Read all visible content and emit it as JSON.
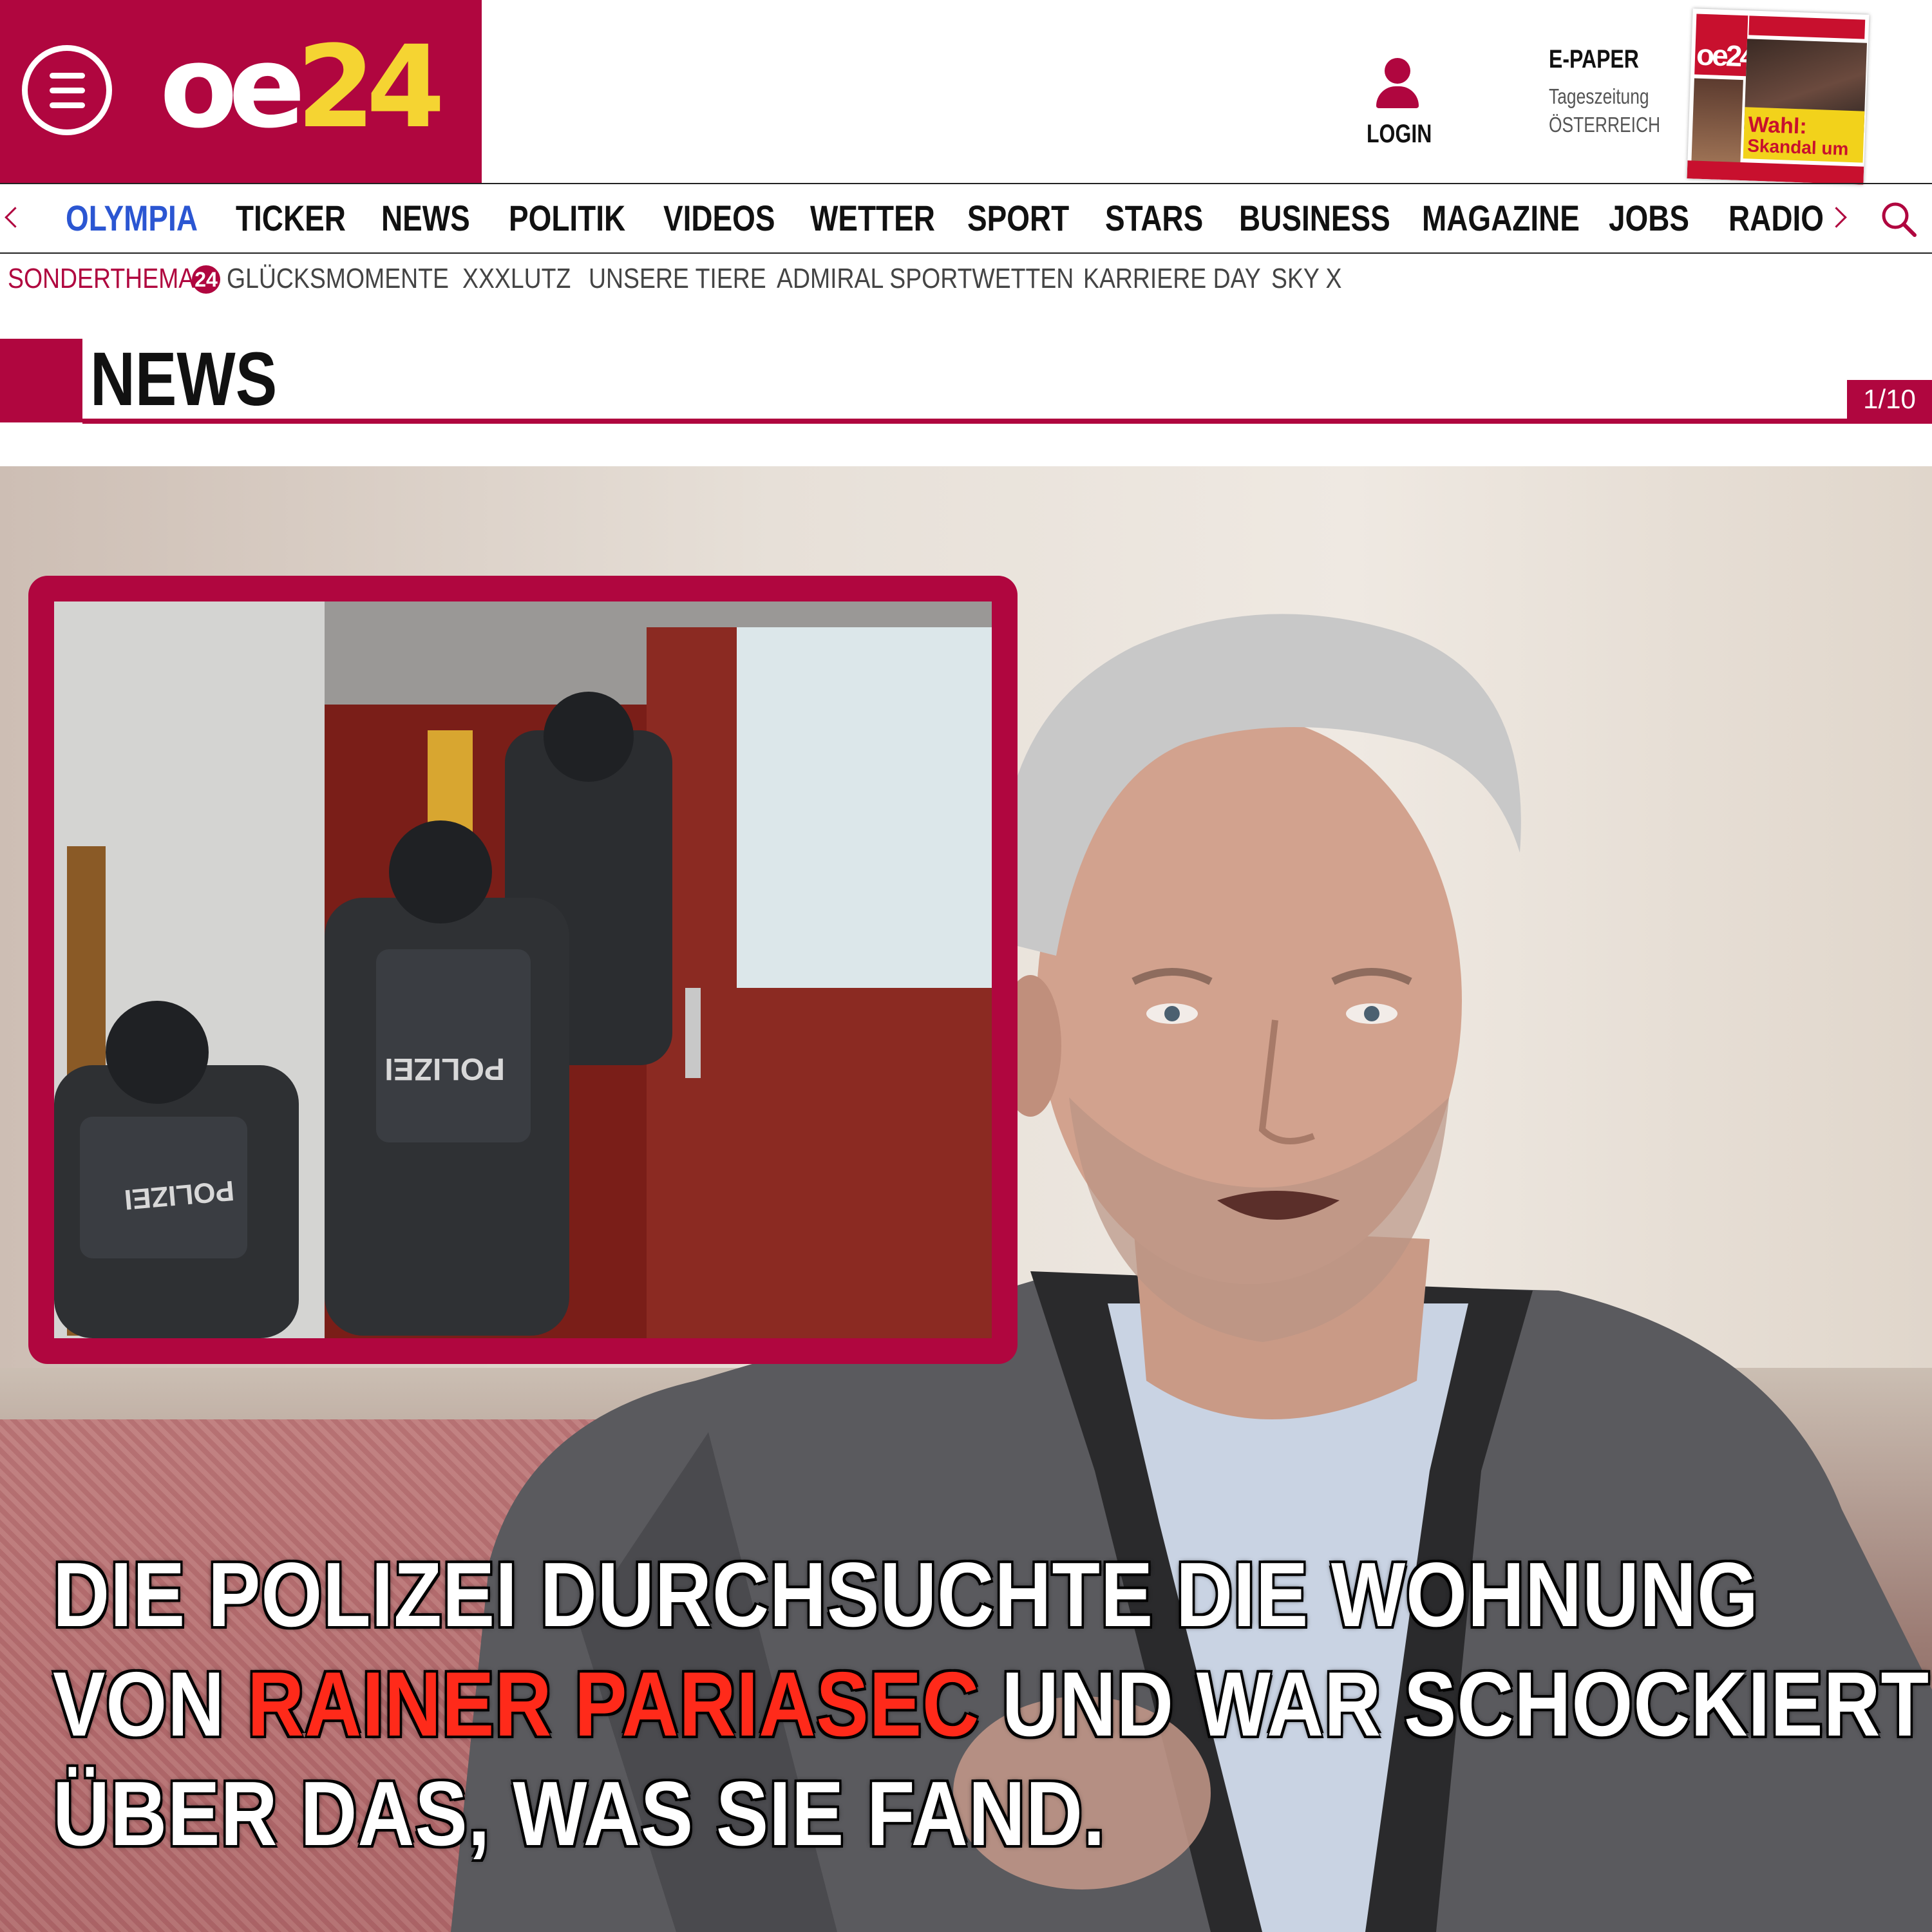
{
  "header": {
    "logo_main": "oe",
    "logo_num": "24",
    "login_label": "LOGIN",
    "epaper_title": "E-PAPER",
    "epaper_sub1": "Tageszeitung",
    "epaper_sub2": "ÖSTERREICH",
    "brand_color": "#b0063f",
    "cover_headline1": "Wahl:",
    "cover_headline2": "Skandal um"
  },
  "nav": {
    "items": [
      "OLYMPIA",
      "TICKER",
      "NEWS",
      "POLITIK",
      "VIDEOS",
      "WETTER",
      "SPORT",
      "STARS",
      "BUSINESS",
      "MAGAZINE",
      "JOBS",
      "RADIO"
    ],
    "active": "OLYMPIA",
    "active_color": "#2b56d2"
  },
  "subnav": {
    "label": "SONDERTHEMA:",
    "badge": "24",
    "items": [
      "GLÜCKSMOMENTE",
      "XXXLUTZ",
      "UNSERE TIERE",
      "ADMIRAL SPORTWETTEN",
      "KARRIERE DAY",
      "SKY X"
    ]
  },
  "section": {
    "title": "NEWS",
    "counter": "1/10"
  },
  "inset": {
    "vest_label_1": "POLIZEI",
    "vest_label_2": "POLIZEI"
  },
  "headline": {
    "line1": "DIE POLIZEI DURCHSUCHTE DIE WOHNUNG",
    "line2_pre": "VON ",
    "line2_name": "RAINER PARIASEC",
    "line2_post": " UND WAR SCHOCKIERT",
    "line3": "ÜBER DAS, WAS SIE FAND.",
    "highlight_color": "#ff2a1a"
  }
}
